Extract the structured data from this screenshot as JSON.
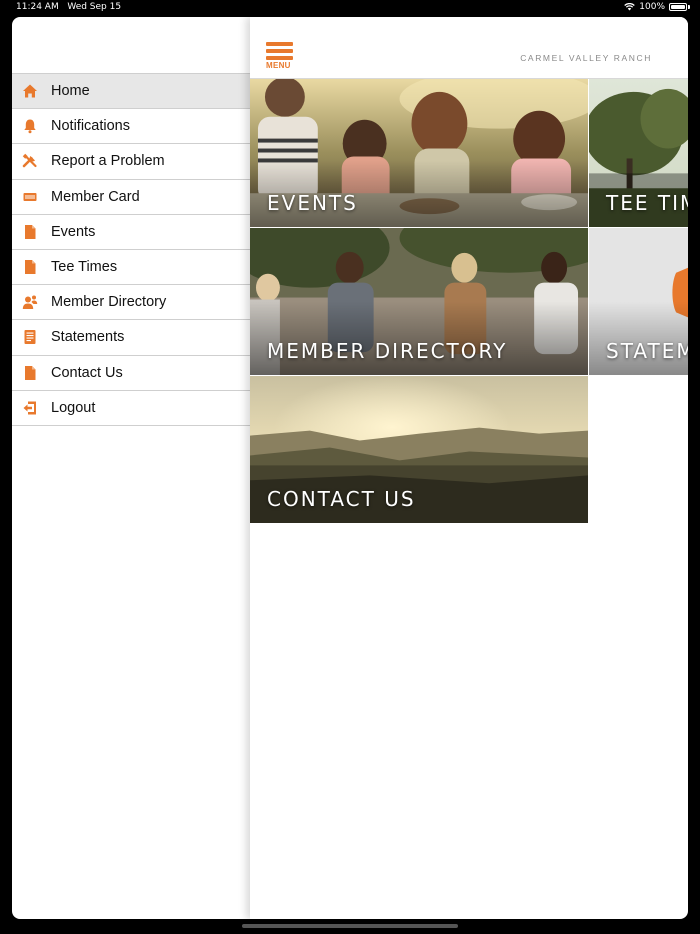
{
  "status_bar": {
    "time": "11:24 AM",
    "date": "Wed Sep 15",
    "battery": "100%"
  },
  "colors": {
    "accent": "#e8792d",
    "active_row": "#e7e7e7"
  },
  "sidebar": {
    "items": [
      {
        "label": "Home",
        "icon": "home-icon",
        "active": true
      },
      {
        "label": "Notifications",
        "icon": "bell-icon"
      },
      {
        "label": "Report a Problem",
        "icon": "tools-icon"
      },
      {
        "label": "Member Card",
        "icon": "card-icon"
      },
      {
        "label": "Events",
        "icon": "document-icon"
      },
      {
        "label": "Tee Times",
        "icon": "document-icon"
      },
      {
        "label": "Member Directory",
        "icon": "people-icon"
      },
      {
        "label": "Statements",
        "icon": "statement-icon"
      },
      {
        "label": "Contact Us",
        "icon": "document-icon"
      },
      {
        "label": "Logout",
        "icon": "logout-icon"
      }
    ]
  },
  "header": {
    "menu_label": "MENU",
    "brand": "CARMEL VALLEY RANCH"
  },
  "tiles": [
    {
      "label": "EVENTS"
    },
    {
      "label": "TEE TIMES"
    },
    {
      "label": "MEMBER DIRECTORY"
    },
    {
      "label": "STATEMENTS"
    },
    {
      "label": "CONTACT US"
    }
  ]
}
